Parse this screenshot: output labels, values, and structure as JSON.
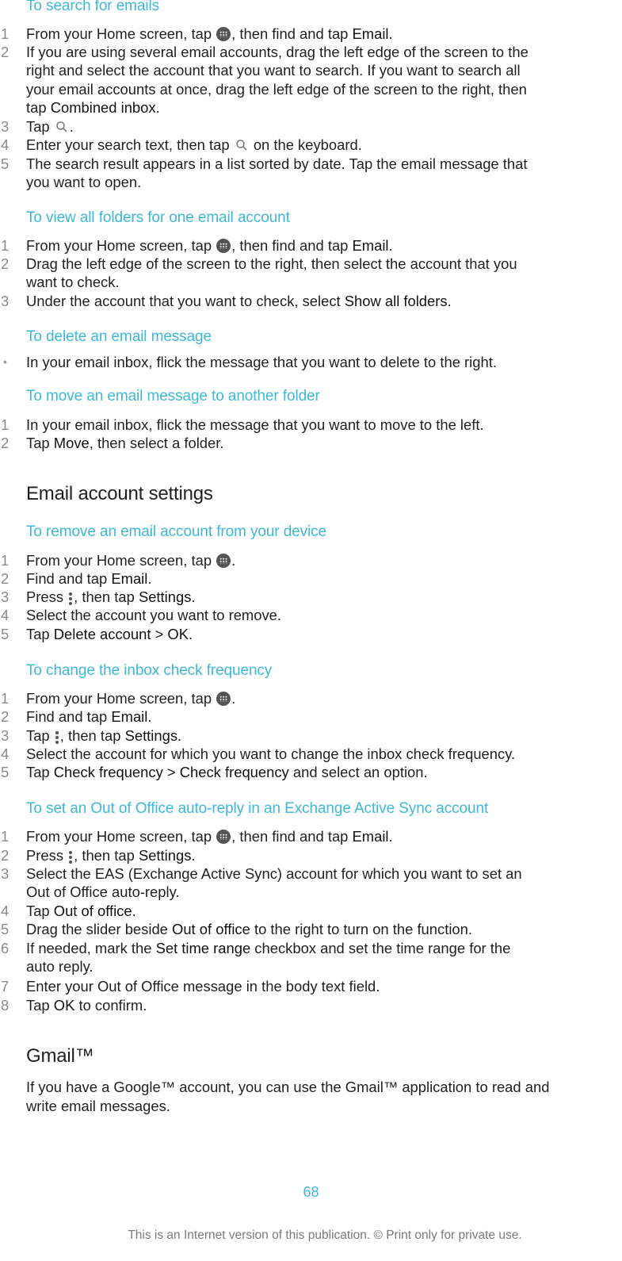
{
  "colors": {
    "accent": "#3db8d8",
    "text": "#1f1f1f",
    "muted": "#8a8a8a"
  },
  "icons": {
    "apps": "apps-grid-icon",
    "search": "search-icon",
    "menu": "overflow-menu-icon"
  },
  "sections": {
    "search": {
      "title": "To search for emails",
      "steps": [
        {
          "num": "1",
          "parts": [
            "From your Home screen, tap ",
            "",
            ", then find and tap ",
            "Email",
            "."
          ]
        },
        {
          "num": "2",
          "lines": [
            "If you are using several email accounts, drag the left edge of the screen to the",
            "right and select the account that you want to search. If you want to search all",
            "your email accounts at once, drag the left edge of the screen to the right, then"
          ],
          "last_pre": "tap ",
          "last_bold": "Combined inbox",
          "last_post": "."
        },
        {
          "num": "3",
          "pre": "Tap ",
          "post": "."
        },
        {
          "num": "4",
          "pre": "Enter your search text, then tap ",
          "post": " on the keyboard."
        },
        {
          "num": "5",
          "lines": [
            "The search result appears in a list sorted by date. Tap the email message that",
            "you want to open."
          ]
        }
      ]
    },
    "folders": {
      "title": "To view all folders for one email account",
      "steps": [
        {
          "num": "1",
          "pre": "From your Home screen, tap ",
          "mid": ", then find and tap ",
          "bold": "Email",
          "post": "."
        },
        {
          "num": "2",
          "lines": [
            "Drag the left edge of the screen to the right, then select the account that you",
            "want to check."
          ]
        },
        {
          "num": "3",
          "pre": "Under the account that you want to check, select ",
          "bold": "Show all folders",
          "post": "."
        }
      ]
    },
    "delete": {
      "title": "To delete an email message",
      "bullet": "•",
      "text": "In your email inbox, flick the message that you want to delete to the right."
    },
    "move": {
      "title": "To move an email message to another folder",
      "steps": [
        {
          "num": "1",
          "text": "In your email inbox, flick the message that you want to move to the left."
        },
        {
          "num": "2",
          "pre": "Tap ",
          "bold": "Move",
          "post": ", then select a folder."
        }
      ]
    },
    "settings_heading": "Email account settings",
    "remove": {
      "title": "To remove an email account from your device",
      "steps": [
        {
          "num": "1",
          "pre": "From your Home screen, tap ",
          "post": "."
        },
        {
          "num": "2",
          "pre": "Find and tap ",
          "bold": "Email",
          "post": "."
        },
        {
          "num": "3",
          "pre": "Press ",
          "mid": ", then tap ",
          "bold": "Settings",
          "post": "."
        },
        {
          "num": "4",
          "text": "Select the account you want to remove."
        },
        {
          "num": "5",
          "pre": "Tap ",
          "bold": "Delete account",
          "mid": " > ",
          "bold2": "OK",
          "post": "."
        }
      ]
    },
    "frequency": {
      "title": "To change the inbox check frequency",
      "steps": [
        {
          "num": "1",
          "pre": "From your Home screen, tap ",
          "post": "."
        },
        {
          "num": "2",
          "pre": "Find and tap ",
          "bold": "Email",
          "post": "."
        },
        {
          "num": "3",
          "pre": "Tap ",
          "mid": ", then tap ",
          "bold": "Settings",
          "post": "."
        },
        {
          "num": "4",
          "text": "Select the account for which you want to change the inbox check frequency."
        },
        {
          "num": "5",
          "pre": "Tap ",
          "bold": "Check frequency",
          "mid": " > ",
          "bold2": "Check frequency",
          "post": " and select an option."
        }
      ]
    },
    "ooo": {
      "title": "To set an Out of Office auto-reply in an Exchange Active Sync account",
      "steps": [
        {
          "num": "1",
          "pre": "From your Home screen, tap ",
          "mid": ", then find and tap ",
          "bold": "Email",
          "post": "."
        },
        {
          "num": "2",
          "pre": "Press ",
          "mid": ", then tap ",
          "bold": "Settings",
          "post": "."
        },
        {
          "num": "3",
          "lines": [
            "Select the EAS (Exchange Active Sync) account for which you want to set an",
            "Out of Office auto-reply."
          ]
        },
        {
          "num": "4",
          "pre": "Tap ",
          "bold": "Out of office",
          "post": "."
        },
        {
          "num": "5",
          "pre": "Drag the slider beside ",
          "bold": "Out of office",
          "post": " to the right to turn on the function."
        },
        {
          "num": "6",
          "pre": "If needed, mark the ",
          "bold": "Set time range",
          "post": " checkbox and set the time range for the",
          "line2": "auto reply."
        },
        {
          "num": "7",
          "text": "Enter your Out of Office message in the body text field."
        },
        {
          "num": "8",
          "pre": "Tap ",
          "bold": "OK",
          "post": " to confirm."
        }
      ]
    },
    "gmail": {
      "heading": "Gmail™",
      "lines": [
        "If you have a Google™ account, you can use the Gmail™ application to read and",
        "write email messages."
      ]
    }
  },
  "page_number": "68",
  "footer": "This is an Internet version of this publication. © Print only for private use."
}
